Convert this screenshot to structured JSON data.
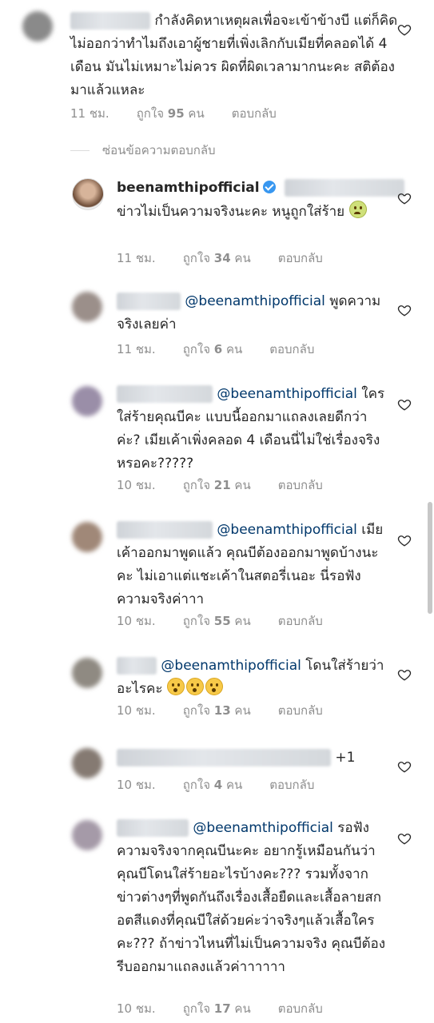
{
  "comments": [
    {
      "text": "กำลังคิดหาเหตุผลเพื่อจะเข้าข้างบี แต่ก็คิดไม่ออกว่าทำไมถึงเอาผู้ชายที่เพิ่งเลิกกับเมียที่คลอดได้ 4 เดือน มันไม่เหมาะไม่ควร ผิดที่ผิดเวลามากนะคะ สติต้องมาแล้วแหละ",
      "time": "11 ชม.",
      "likes_prefix": "ถูกใจ",
      "likes": "95",
      "likes_suffix": "คน",
      "reply": "ตอบกลับ"
    },
    {
      "username": "beenamthipofficial",
      "text": "ข่าวไม่เป็นความจริงนะคะ หนูถูกใส่ร้าย",
      "time": "11 ชม.",
      "likes_prefix": "ถูกใจ",
      "likes": "34",
      "likes_suffix": "คน",
      "reply": "ตอบกลับ"
    },
    {
      "mention": "@beenamthipofficial",
      "text": "พูดความจริงเลยค่า",
      "time": "11 ชม.",
      "likes_prefix": "ถูกใจ",
      "likes": "6",
      "likes_suffix": "คน",
      "reply": "ตอบกลับ"
    },
    {
      "mention": "@beenamthipofficial",
      "text": "ใครใส่ร้ายคุณบีคะ แบบนี้ออกมาแถลงเลยดีกว่าค่ะ? เมียเค้าเพิ่งคลอด 4 เดือนนี่ไม่ใช่เรื่องจริงหรอคะ?????",
      "time": "10 ชม.",
      "likes_prefix": "ถูกใจ",
      "likes": "21",
      "likes_suffix": "คน",
      "reply": "ตอบกลับ"
    },
    {
      "mention": "@beenamthipofficial",
      "text": "เมียเค้าออกมาพูดแล้ว คุณบีต้องออกมาพูดบ้างนะคะ ไม่เอาแต่แชะเค้าในสตอรี่เนอะ นี่รอฟังความจริงค่าาา",
      "time": "10 ชม.",
      "likes_prefix": "ถูกใจ",
      "likes": "55",
      "likes_suffix": "คน",
      "reply": "ตอบกลับ"
    },
    {
      "mention": "@beenamthipofficial",
      "text": "โดนใส่ร้ายว่าอะไรคะ",
      "time": "10 ชม.",
      "likes_prefix": "ถูกใจ",
      "likes": "13",
      "likes_suffix": "คน",
      "reply": "ตอบกลับ"
    },
    {
      "text": "+1",
      "time": "10 ชม.",
      "likes_prefix": "ถูกใจ",
      "likes": "4",
      "likes_suffix": "คน",
      "reply": "ตอบกลับ"
    },
    {
      "mention": "@beenamthipofficial",
      "text": "รอฟังความจริงจากคุณบีนะคะ อยากรู้เหมือนกันว่าคุณบีโดนใส่ร้ายอะไรบ้างคะ??? รวมทั้งจากข่าวต่างๆที่พูดกันถึงเรื่องเสื้อยืดและเสื้อลายสกอตสีแดงที่คุณบีใส่ด้วยค่ะว่าจริงๆแล้วเสื้อใครคะ??? ถ้าข่าวไหนที่ไม่เป็นความจริง คุณบีต้องรีบออกมาแถลงแล้วค่าาาาาา",
      "time": "10 ชม.",
      "likes_prefix": "ถูกใจ",
      "likes": "17",
      "likes_suffix": "คน",
      "reply": "ตอบกลับ"
    }
  ],
  "hide_replies": "ซ่อนข้อความตอบกลับ",
  "icons": {
    "like": "heart-outline-icon",
    "verified": "verified-badge-icon",
    "emoji_sad": "worried-face-emoji",
    "emoji_surprised": "hushed-face-emoji"
  }
}
